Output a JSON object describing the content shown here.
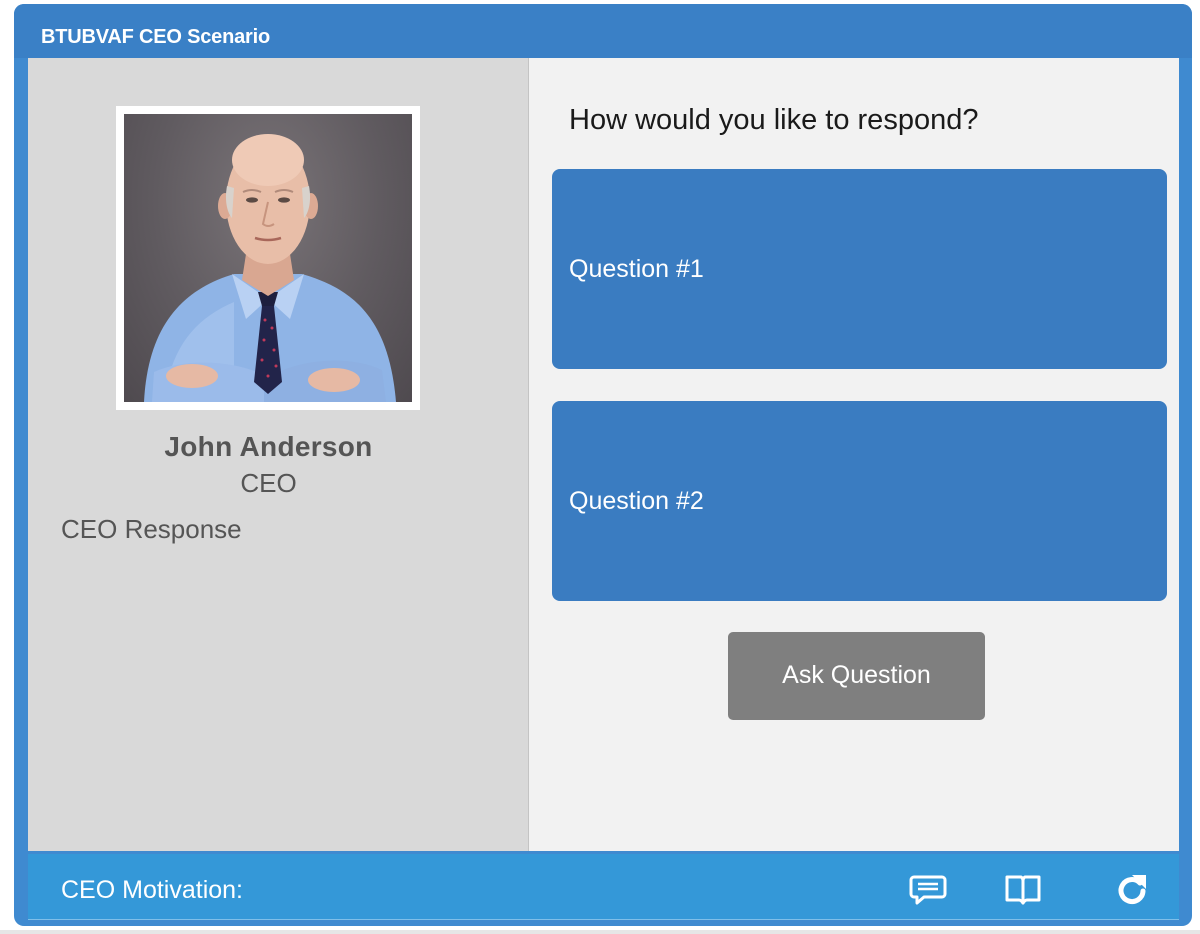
{
  "window": {
    "title": "BTUBVAF CEO Scenario"
  },
  "character": {
    "name": "John Anderson",
    "role": "CEO",
    "response_label": "CEO Response"
  },
  "dialog": {
    "prompt": "How would you like to respond?",
    "options": [
      {
        "label": "Question #1"
      },
      {
        "label": "Question #2"
      }
    ],
    "ask_button_label": "Ask Question"
  },
  "footer": {
    "motivation_label": "CEO Motivation:",
    "icons": [
      "chat-icon",
      "book-icon",
      "reload-icon"
    ]
  },
  "colors": {
    "titlebar": "#3a80c6",
    "answer_button": "#3a7cc1",
    "ask_button": "#7f7f7f",
    "footer": "#3498d8",
    "left_panel": "#d9d9d9",
    "right_panel": "#f2f2f2"
  }
}
